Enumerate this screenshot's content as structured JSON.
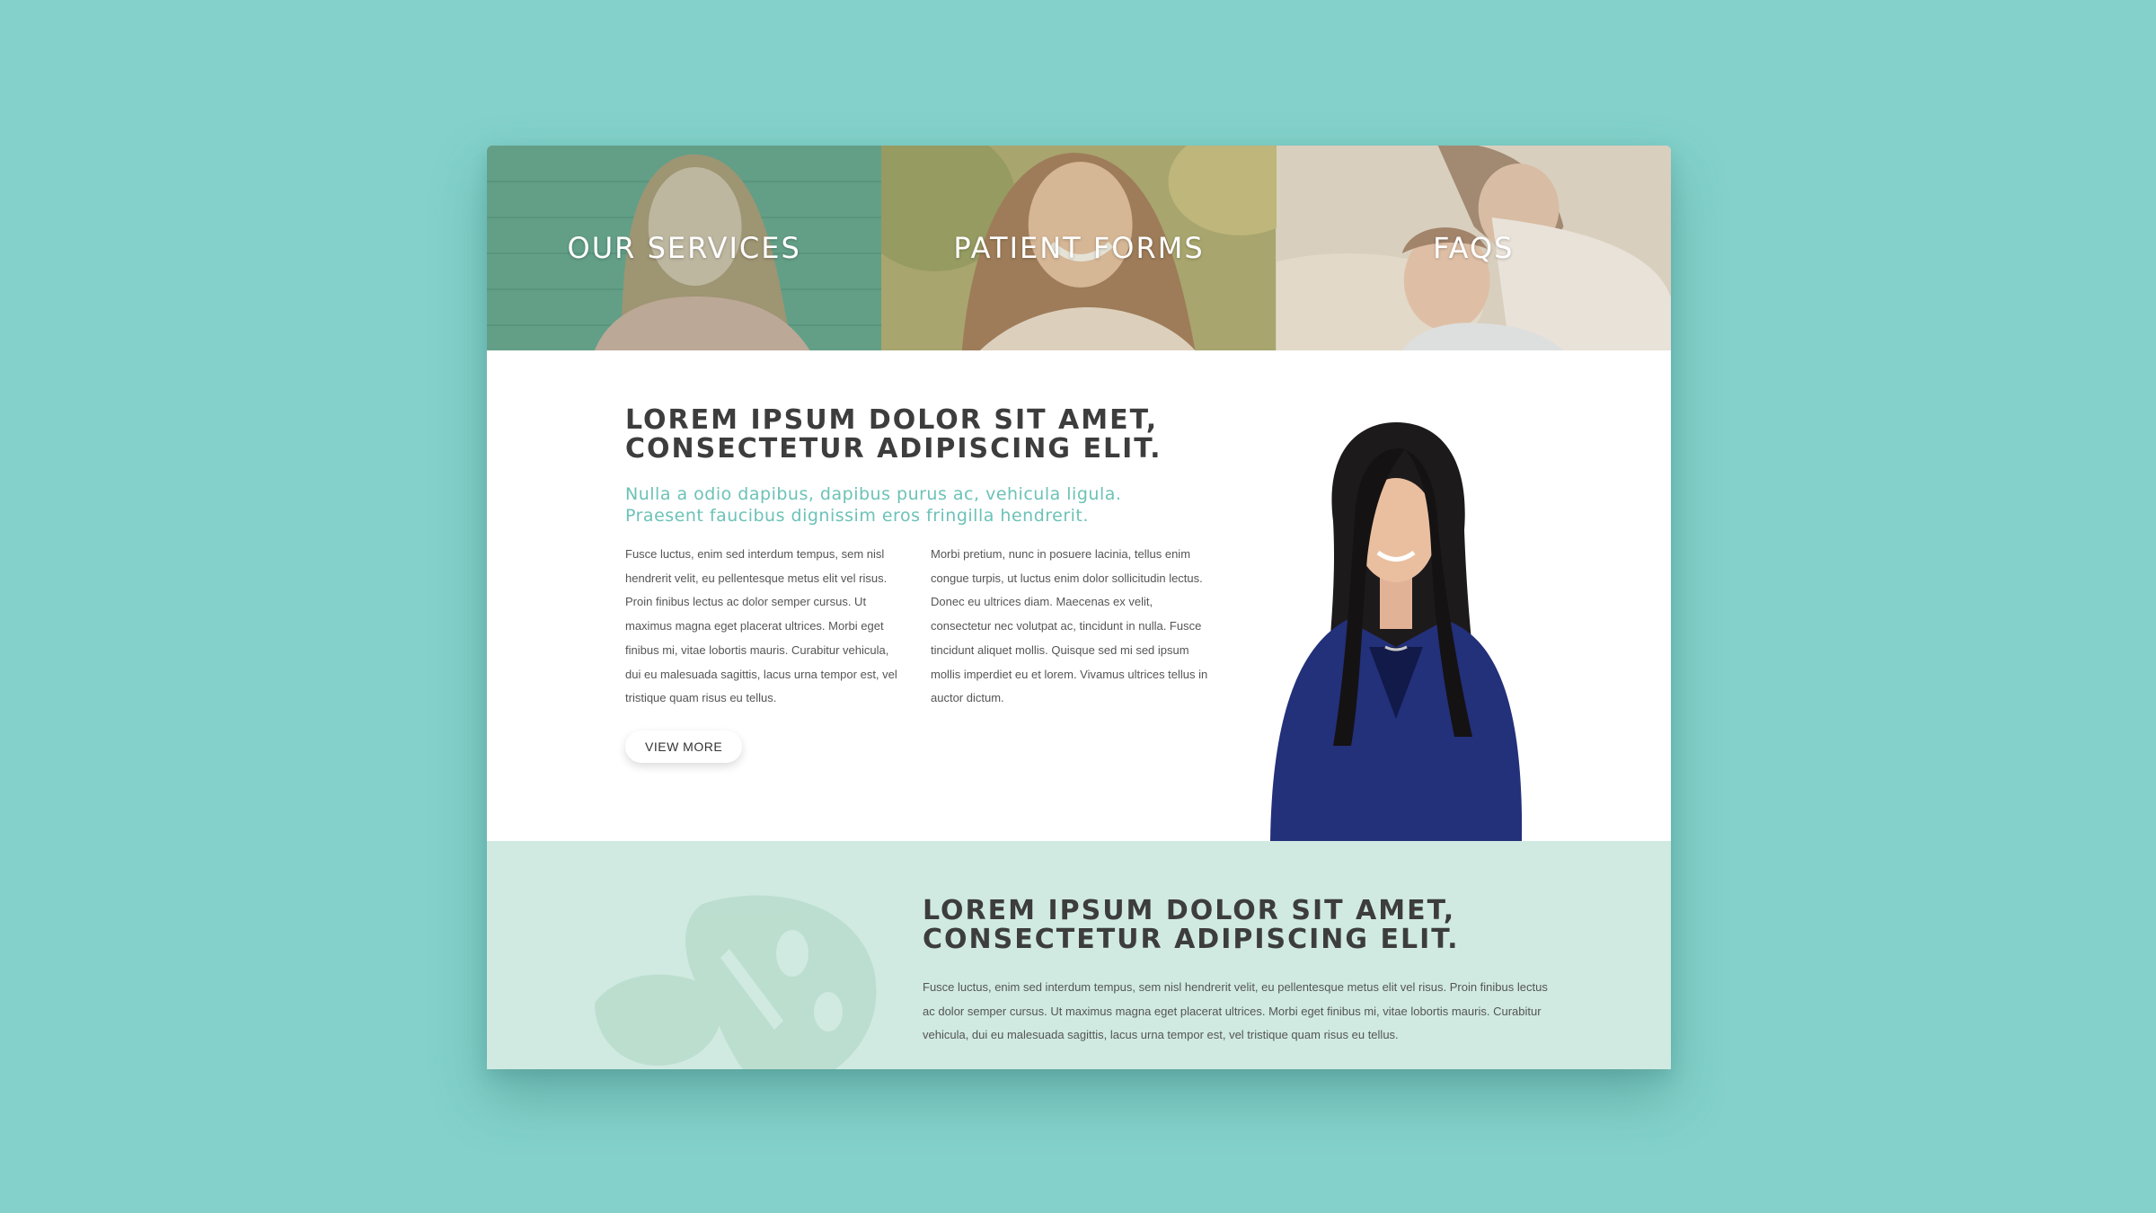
{
  "tiles": [
    {
      "label": "OUR SERVICES"
    },
    {
      "label": "PATIENT FORMS"
    },
    {
      "label": "FAQS"
    }
  ],
  "intro": {
    "heading_line1": "LOREM IPSUM DOLOR SIT AMET,",
    "heading_line2": "CONSECTETUR ADIPISCING ELIT.",
    "subtitle": "Nulla a odio dapibus, dapibus purus ac, vehicula ligula. Praesent faucibus dignissim eros fringilla hendrerit.",
    "col1": "Fusce luctus, enim sed interdum tempus, sem nisl hendrerit velit, eu pellentesque metus elit vel risus. Proin finibus lectus ac dolor semper cursus. Ut maximus magna eget placerat ultrices. Morbi eget finibus mi, vitae lobortis mauris. Curabitur vehicula, dui eu malesuada sagittis, lacus urna tempor est, vel tristique quam risus eu tellus.",
    "col2": "Morbi pretium, nunc in posuere lacinia, tellus enim congue turpis, ut luctus enim dolor sollicitudin lectus. Donec eu ultrices diam. Maecenas ex velit, consectetur nec volutpat ac, tincidunt in nulla. Fusce tincidunt aliquet mollis. Quisque sed mi sed ipsum mollis imperdiet eu et lorem. Vivamus ultrices tellus in auctor dictum.",
    "button_label": "VIEW MORE"
  },
  "section2": {
    "heading_line1": "LOREM IPSUM DOLOR SIT AMET,",
    "heading_line2": "CONSECTETUR ADIPISCING ELIT.",
    "body": "Fusce luctus, enim sed interdum tempus, sem nisl hendrerit velit, eu pellentesque metus elit vel risus. Proin finibus lectus ac dolor semper cursus. Ut maximus magna eget placerat ultrices. Morbi eget finibus mi, vitae lobortis mauris. Curabitur vehicula, dui eu malesuada sagittis, lacus urna tempor est, vel tristique quam risus eu tellus."
  },
  "colors": {
    "background": "#83d1ca",
    "accent": "#6cc2b7",
    "section2_bg": "#d0eae1",
    "heading": "#3d3d3d"
  },
  "icons": [
    "monstera-leaf-decoration"
  ]
}
